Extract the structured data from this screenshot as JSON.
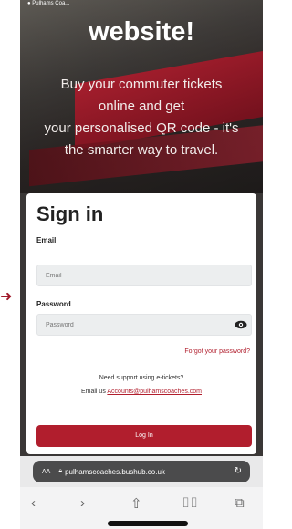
{
  "page": {
    "status_text": "● Pulhams Coa...",
    "hero_title": "website!",
    "hero_lines": [
      "Buy your commuter tickets",
      "online and get",
      "your personalised QR code - it's",
      "the smarter way to travel."
    ],
    "arrow_icon": "arrow-right-icon"
  },
  "signin": {
    "title": "Sign in",
    "email_label": "Email",
    "email_placeholder": "Email",
    "password_label": "Password",
    "password_placeholder": "Password",
    "forgot_text": "Forgot your password?",
    "support_line1": "Need support using e-tickets?",
    "support_line2_prefix": "Email us",
    "support_email": "Accounts@pulhamscoaches.com",
    "login_label": "Log In"
  },
  "browser": {
    "aa_label": "AA",
    "url": "pulhamscoaches.bushub.co.uk",
    "reload_icon": "reload-icon",
    "toolbar_icons": [
      "back-icon",
      "forward-icon",
      "share-icon",
      "bookmarks-icon",
      "tabs-icon"
    ]
  },
  "colors": {
    "accent": "#b11e2d",
    "url_pill": "#4b4b4c"
  }
}
